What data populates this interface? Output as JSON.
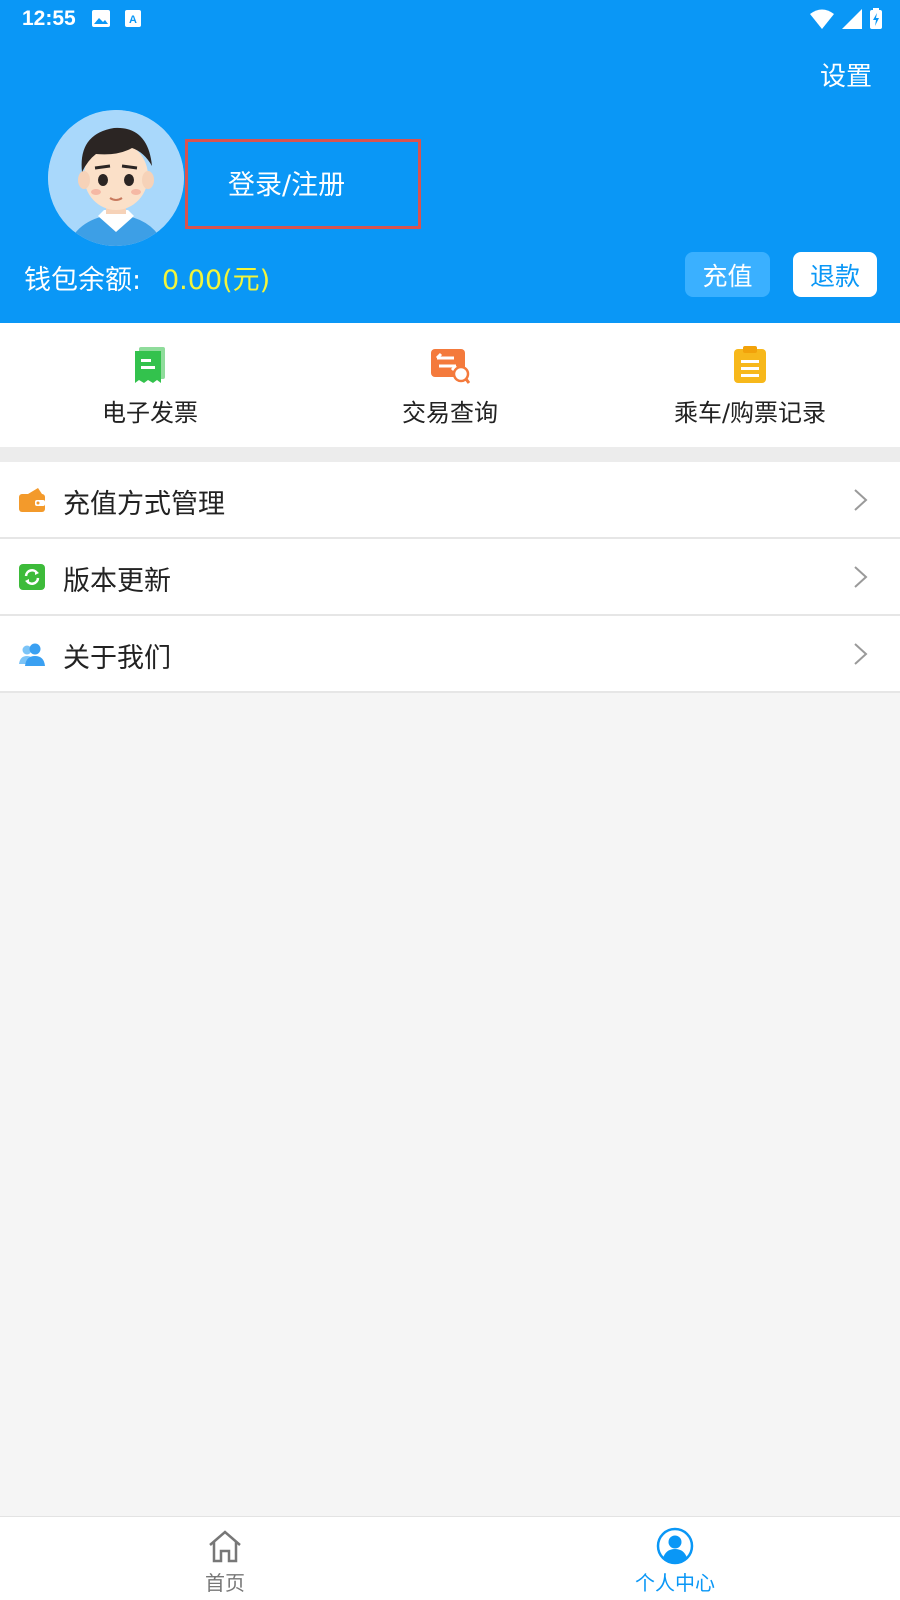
{
  "status_bar": {
    "time": "12:55",
    "icons": [
      "image-icon",
      "font-icon",
      "wifi-icon",
      "signal-icon",
      "battery-icon"
    ]
  },
  "header": {
    "settings_label": "设置",
    "login_label": "登录/注册",
    "wallet_label": "钱包余额:",
    "wallet_value": "0.00(元)",
    "recharge_label": "充值",
    "refund_label": "退款"
  },
  "quick_actions": [
    {
      "label": "电子发票",
      "icon": "receipt-icon",
      "color": "#33c24d"
    },
    {
      "label": "交易查询",
      "icon": "transaction-search-icon",
      "color": "#f47a3c"
    },
    {
      "label": "乘车/购票记录",
      "icon": "clipboard-icon",
      "color": "#f7b81b"
    }
  ],
  "menu": [
    {
      "label": "充值方式管理",
      "icon": "wallet-icon",
      "color": "#f39a2b"
    },
    {
      "label": "版本更新",
      "icon": "refresh-icon",
      "color": "#3dbb3a"
    },
    {
      "label": "关于我们",
      "icon": "users-icon",
      "color": "#3aa0f2"
    }
  ],
  "bottom_nav": [
    {
      "label": "首页",
      "icon": "home-icon",
      "active": false
    },
    {
      "label": "个人中心",
      "icon": "user-profile-icon",
      "active": true
    }
  ],
  "colors": {
    "primary": "#0a97f6",
    "wallet_value": "#f3f53a",
    "active_nav": "#0a97f6",
    "inactive_nav": "#777777"
  }
}
